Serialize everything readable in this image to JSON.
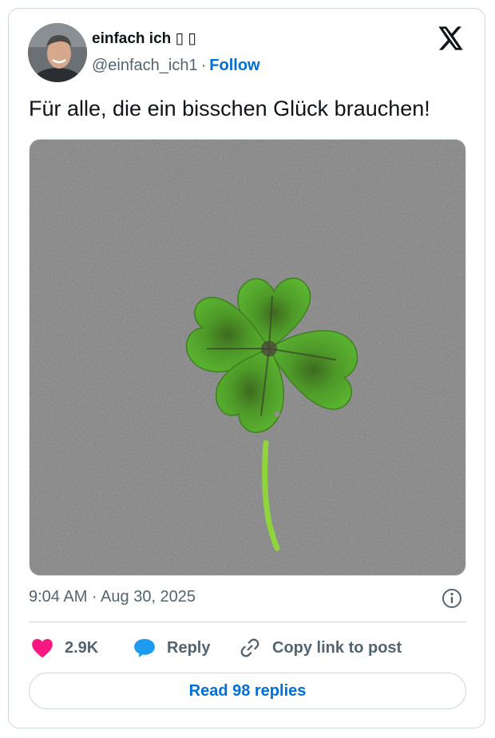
{
  "author": {
    "display_name": "einfach ich ▯ ▯",
    "handle": "@einfach_ich1",
    "separator": "·",
    "follow_label": "Follow"
  },
  "tweet": {
    "text": "Für alle, die ein bisschen Glück brauchen!",
    "timestamp": "9:04 AM · Aug 30, 2025"
  },
  "actions": {
    "likes_count": "2.9K",
    "reply_label": "Reply",
    "copy_link_label": "Copy link to post"
  },
  "read_replies_label": "Read 98 replies",
  "icons": {
    "platform_logo": "x-logo-icon",
    "info": "info-icon",
    "like": "heart-icon",
    "reply": "speech-bubble-icon",
    "copy_link": "link-icon"
  },
  "colors": {
    "like": "#f91880",
    "reply": "#1d9bf0",
    "link": "#006fd6",
    "muted": "#536471",
    "border": "#cfd9de"
  }
}
